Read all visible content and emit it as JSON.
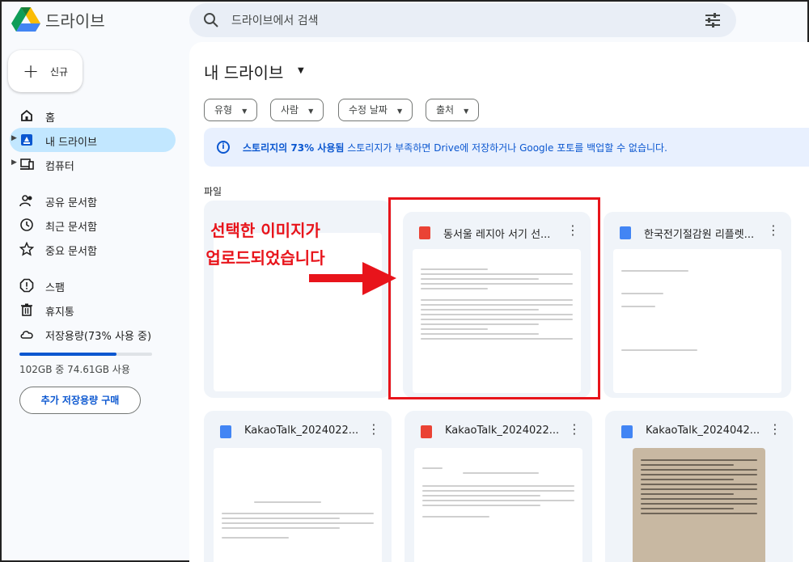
{
  "app": {
    "title": "드라이브"
  },
  "search": {
    "placeholder": "드라이브에서 검색",
    "icon": "search-icon",
    "filter_icon": "tune-icon"
  },
  "sidebar": {
    "new_label": "신규",
    "items": [
      {
        "label": "홈",
        "icon": "home-icon"
      },
      {
        "label": "내 드라이브",
        "icon": "drive-icon",
        "active": true
      },
      {
        "label": "컴퓨터",
        "icon": "computer-icon"
      },
      {
        "label": "공유 문서함",
        "icon": "shared-icon"
      },
      {
        "label": "최근 문서함",
        "icon": "clock-icon"
      },
      {
        "label": "중요 문서함",
        "icon": "star-icon"
      },
      {
        "label": "스팸",
        "icon": "spam-icon"
      },
      {
        "label": "휴지통",
        "icon": "trash-icon"
      },
      {
        "label": "저장용량(73% 사용 중)",
        "icon": "cloud-icon"
      }
    ],
    "storage": {
      "used_fraction": 0.73,
      "text": "102GB 중 74.61GB 사용"
    },
    "buy_label": "추가 저장용량 구매"
  },
  "main": {
    "title": "내 드라이브",
    "filters": [
      "유형",
      "사람",
      "수정 날짜",
      "출처"
    ],
    "banner": {
      "bold": "스토리지의 73% 사용됨",
      "text": " 스토리지가 부족하면 Drive에 저장하거나 Google 포토를 백업할 수 없습니다."
    },
    "section_label": "파일",
    "files": [
      {
        "title": "",
        "type": "blank"
      },
      {
        "title": "동서울 레지아 서기 선...",
        "type": "image"
      },
      {
        "title": "한국전기절감원 리플렛...",
        "type": "doc"
      },
      {
        "title": "KakaoTalk_2024022...",
        "type": "doc"
      },
      {
        "title": "KakaoTalk_2024022...",
        "type": "image"
      },
      {
        "title": "KakaoTalk_2024042...",
        "type": "doc"
      }
    ]
  },
  "annotation": {
    "line1": "선택한 이미지가",
    "line2": "업로드되었습니다"
  },
  "colors": {
    "accent": "#0b57d0",
    "active_nav": "#c2e7ff",
    "annotation": "#e8141b",
    "doc_blue": "#4285f4",
    "image_red": "#ea4335"
  }
}
